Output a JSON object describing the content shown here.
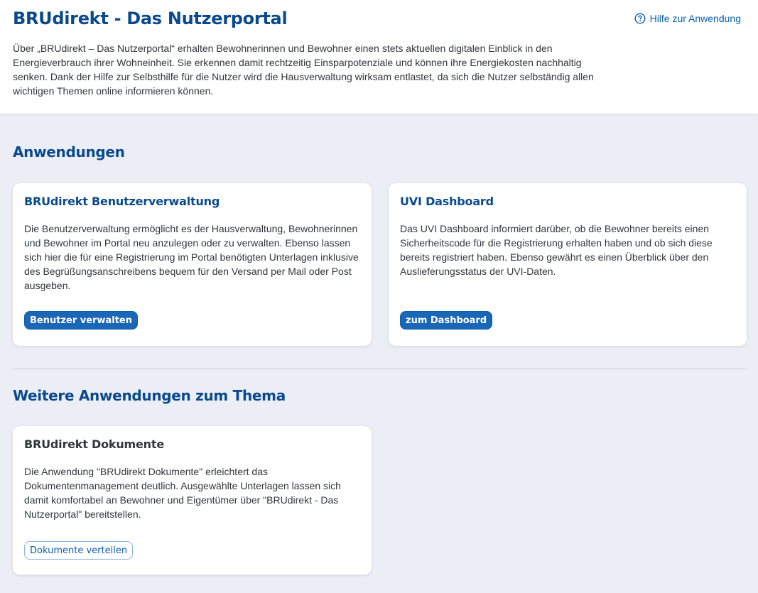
{
  "header": {
    "title": "BRUdirekt - Das Nutzerportal",
    "help_label": "Hilfe zur Anwendung",
    "intro": "Über „BRUdirekt – Das Nutzerportal“ erhalten Bewohnerinnen und Bewohner einen stets aktuellen digitalen Einblick in den Energieverbrauch ihrer Wohneinheit. Sie erkennen damit rechtzeitig Einsparpotenziale und können ihre Energiekosten nachhaltig senken. Dank der Hilfe zur Selbsthilfe für die Nutzer wird die Hausverwaltung wirksam entlastet, da sich die Nutzer selbständig allen wichtigen Themen online informieren können."
  },
  "sections": {
    "apps_title": "Anwendungen",
    "more_title": "Weitere Anwendungen zum Thema"
  },
  "cards": {
    "user_admin": {
      "title": "BRUdirekt Benutzerverwaltung",
      "text": "Die Benutzerverwaltung ermöglicht es der Hausverwaltung, Bewohnerinnen und Bewohner im Portal neu anzulegen oder zu verwalten. Ebenso lassen sich hier die für eine Registrierung im Portal benötigten Unterlagen inklusive des Begrüßungsanschreibens bequem für den Versand per Mail oder Post ausgeben.",
      "button": "Benutzer verwalten"
    },
    "uvi_dashboard": {
      "title": "UVI Dashboard",
      "text": "Das UVI Dashboard informiert darüber, ob die Bewohner bereits einen Sicherheitscode für die Registrierung erhalten haben und ob sich diese bereits registriert haben. Ebenso gewährt es einen Überblick über den Auslieferungsstatus der UVI-Daten.",
      "button": "zum Dashboard"
    },
    "documents": {
      "title": "BRUdirekt Dokumente",
      "text": "Die Anwendung \"BRUdirekt Dokumente\" erleichtert das Dokumentenmanagement deutlich. Ausgewählte Unterlagen lassen sich damit komfortabel an Bewohner und Eigentümer über \"BRUdirekt - Das Nutzerportal\" bereitstellen.",
      "button": "Dokumente verteilen"
    }
  },
  "colors": {
    "brand_blue": "#0a4a8c",
    "button_blue": "#1a67b8",
    "page_background": "#eceef5"
  },
  "icons": {
    "help": "question-circle-icon"
  }
}
